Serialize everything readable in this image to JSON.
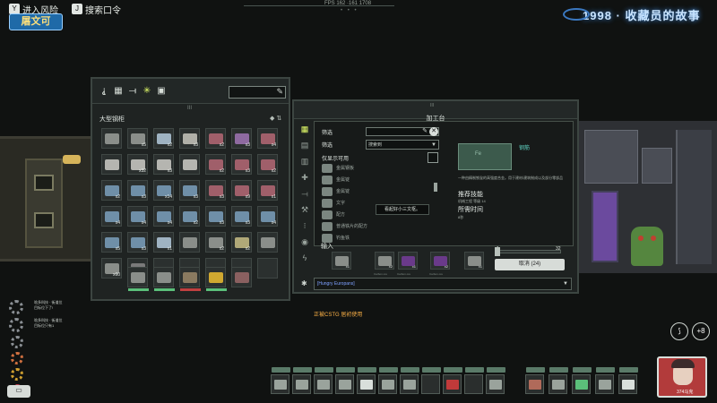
{
  "hud": {
    "buttons": [
      {
        "key": "Y",
        "label": "进入风险"
      },
      {
        "key": "J",
        "label": "搜索口令"
      }
    ],
    "user_badge": "屠文可",
    "fps": "FPS 162   ·161 1708",
    "title_banner": "1998 · 收藏员的故事"
  },
  "inventory": {
    "title": "大型钢柜",
    "subtitle": "III",
    "tab_icons": [
      "wrench-icon",
      "grid-icon",
      "rifle-icon",
      "star-icon",
      "medkit-icon"
    ],
    "search_placeholder": "",
    "slots": [
      {
        "color": "#8a8e8a",
        "count": ""
      },
      {
        "color": "#8a8e8a",
        "count": "x5"
      },
      {
        "color": "#9fb3c2",
        "count": "x2"
      },
      {
        "color": "#b0b0a8",
        "count": "x3"
      },
      {
        "color": "#a05f6a",
        "count": "x2"
      },
      {
        "color": "#8e6aa0",
        "count": "x3"
      },
      {
        "color": "#a05f6a",
        "count": "x4"
      },
      {
        "color": "#b5b5b0",
        "count": ""
      },
      {
        "color": "#b5b5b0",
        "count": "x32"
      },
      {
        "color": "#b5b5b0",
        "count": "x3"
      },
      {
        "color": "#b5b5b0",
        "count": ""
      },
      {
        "color": "#a05f6a",
        "count": "x2"
      },
      {
        "color": "#a05f6a",
        "count": "x3"
      },
      {
        "color": "#a05f6a",
        "count": "x2"
      },
      {
        "color": "#6f8fa8",
        "count": "x2"
      },
      {
        "color": "#6f8fa8",
        "count": "x3"
      },
      {
        "color": "#6f8fa8",
        "count": "x14"
      },
      {
        "color": "#6f8fa8",
        "count": "x3"
      },
      {
        "color": "#a05f6a",
        "count": "x3"
      },
      {
        "color": "#a05f6a",
        "count": "x9"
      },
      {
        "color": "#a05f6a",
        "count": "x1"
      },
      {
        "color": "#6f8fa8",
        "count": "x4"
      },
      {
        "color": "#6f8fa8",
        "count": "x4"
      },
      {
        "color": "#6f8fa8",
        "count": "x4"
      },
      {
        "color": "#6f8fa8",
        "count": "x2"
      },
      {
        "color": "#6f8fa8",
        "count": "x3"
      },
      {
        "color": "#6f8fa8",
        "count": "x3"
      },
      {
        "color": "#6f8fa8",
        "count": "x4"
      },
      {
        "color": "#6f8fa8",
        "count": "x5"
      },
      {
        "color": "#6f8fa8",
        "count": "x3"
      },
      {
        "color": "#9fb3c2",
        "count": "x1"
      },
      {
        "color": "#8a8e8a",
        "count": ""
      },
      {
        "color": "#8a8e8a",
        "count": "x2"
      },
      {
        "color": "#b0a878",
        "count": "x2"
      },
      {
        "color": "#8a8e8a",
        "count": ""
      },
      {
        "color": "#8a8e8a",
        "count": "x60"
      },
      {
        "color": "#7a7a7a",
        "count": ""
      },
      {
        "color": "",
        "count": ""
      },
      {
        "color": "",
        "count": ""
      },
      {
        "color": "",
        "count": ""
      },
      {
        "color": "",
        "count": ""
      },
      {
        "color": "",
        "count": ""
      }
    ],
    "equip": [
      {
        "color": "#8a8e8a",
        "bar": "#5bbf7a"
      },
      {
        "color": "#8a8e8a",
        "bar": "#5bbf7a"
      },
      {
        "color": "#8a7a60",
        "bar": "#c04040"
      },
      {
        "color": "#d0a830",
        "bar": "#5bbf7a"
      },
      {
        "color": "#8a6060",
        "bar": ""
      }
    ]
  },
  "crafting": {
    "title": "加工台",
    "header_mark": "III",
    "filter_label": "筛选",
    "sort_label": "筛选",
    "sort_value": "搜索到",
    "only_available_label": "仅显示可用",
    "recipes": [
      "金属钢板",
      "金属锭",
      "金属锭",
      "文字",
      "配方",
      "普通铁片的配方",
      "钓鱼铁"
    ],
    "tooltip": "看起好小三文枢。",
    "selected_name": "钢筋",
    "selected_icon_text": "Fe",
    "description": "一种由精制铁锭的高强度合金。用于建材/建筑制成以及部分零部品",
    "skill_heading": "推荐技能",
    "skill_text": "机械工程 等级 14",
    "time_heading": "所需时间",
    "time_text": "8秒",
    "input_label": "输入",
    "qty_min": "1",
    "qty_max": "32",
    "ingredients": [
      {
        "color": "#8a8e8a",
        "count": "x1",
        "caption": ""
      },
      {
        "color": "#8a8e8a",
        "count": "x2",
        "caption": "Carbon ore"
      },
      {
        "color": "#6a3a8a",
        "count": "x1",
        "caption": "Carbon ore"
      },
      {
        "color": "#6a3a8a",
        "count": "x2",
        "caption": "Carbon ore"
      },
      {
        "color": "#8a8e8a",
        "count": "x1",
        "caption": ""
      },
      {
        "color": "#6f8fa8",
        "count": "x2",
        "caption": ""
      }
    ],
    "cancel_button": "取消 (24)",
    "server_value": "[Hungry Europans]",
    "status_message": "正被CSTG 居初使用"
  },
  "notifications": [
    {
      "line1": "啥多科技 · 街道位",
      "line2": "目标位下了!"
    },
    {
      "line1": "啥多科技 · 街道位",
      "line2": "目标位只有1"
    }
  ],
  "side_gears": [
    "#8a8f94",
    "#d07040",
    "#d0a030",
    "#c04050"
  ],
  "hotbar_left": [
    {
      "color": "#9aa39c",
      "count": ""
    },
    {
      "color": "#9aa39c",
      "count": ""
    },
    {
      "color": "#9aa39c",
      "count": ""
    },
    {
      "color": "#9aa39c",
      "count": ""
    },
    {
      "color": "#d9dfdb",
      "count": ""
    },
    {
      "color": "#9aa39c",
      "count": ""
    },
    {
      "color": "#9aa39c",
      "count": ""
    },
    {
      "color": "",
      "count": ""
    },
    {
      "color": "#c03a3a",
      "count": ""
    },
    {
      "color": "",
      "count": ""
    },
    {
      "color": "#9aa39c",
      "count": ""
    }
  ],
  "hotbar_right": [
    {
      "color": "#b06a5a",
      "count": ""
    },
    {
      "color": "#9aa39c",
      "count": ""
    },
    {
      "color": "#5bbf7a",
      "count": ""
    },
    {
      "color": "#9aa39c",
      "count": ""
    },
    {
      "color": "#d9dfdb",
      "count": ""
    }
  ],
  "round_buttons": [
    "ammo-icon",
    "+8"
  ],
  "player": {
    "money": "374马克"
  }
}
